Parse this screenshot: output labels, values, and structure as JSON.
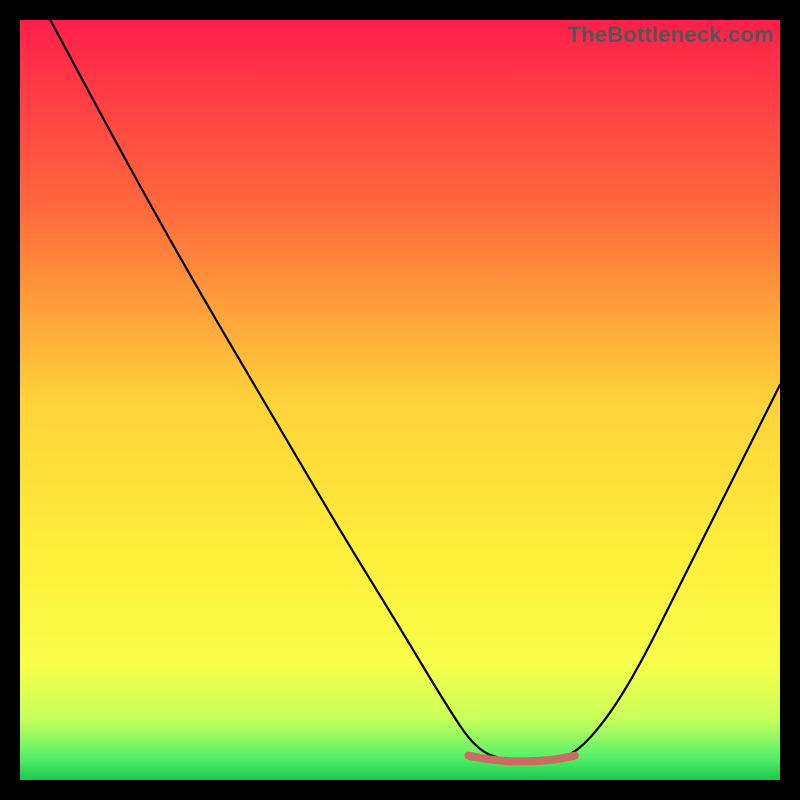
{
  "watermark": "TheBottleneck.com",
  "chart_data": {
    "type": "line",
    "title": "",
    "xlabel": "",
    "ylabel": "",
    "xlim": [
      0,
      100
    ],
    "ylim": [
      0,
      100
    ],
    "grid": false,
    "legend": false,
    "background_gradient": {
      "stops": [
        {
          "offset": 0.0,
          "color": "#ff1f4b"
        },
        {
          "offset": 0.25,
          "color": "#ff6a3c"
        },
        {
          "offset": 0.5,
          "color": "#ffd23a"
        },
        {
          "offset": 0.7,
          "color": "#ffee3a"
        },
        {
          "offset": 0.85,
          "color": "#f7ff4a"
        },
        {
          "offset": 0.92,
          "color": "#c8ff5a"
        },
        {
          "offset": 0.97,
          "color": "#57f06a"
        },
        {
          "offset": 1.0,
          "color": "#18c94a"
        }
      ]
    },
    "black_curve": {
      "description": "V-shaped line: steep descent from top-left, flat trough ~60-72, rise to right edge mid-height",
      "points": [
        {
          "x": 4,
          "y": 100
        },
        {
          "x": 12,
          "y": 85
        },
        {
          "x": 22,
          "y": 67
        },
        {
          "x": 32,
          "y": 50
        },
        {
          "x": 42,
          "y": 33
        },
        {
          "x": 50,
          "y": 20
        },
        {
          "x": 56,
          "y": 10
        },
        {
          "x": 60,
          "y": 4
        },
        {
          "x": 64,
          "y": 2.5
        },
        {
          "x": 70,
          "y": 2.5
        },
        {
          "x": 74,
          "y": 4
        },
        {
          "x": 80,
          "y": 12
        },
        {
          "x": 88,
          "y": 28
        },
        {
          "x": 96,
          "y": 44
        },
        {
          "x": 100,
          "y": 52
        }
      ]
    },
    "marker_trough": {
      "color": "#cc6b63",
      "thickness": 8,
      "points": [
        {
          "x": 59,
          "y": 3.2
        },
        {
          "x": 62,
          "y": 2.6
        },
        {
          "x": 66,
          "y": 2.4
        },
        {
          "x": 70,
          "y": 2.6
        },
        {
          "x": 73,
          "y": 3.2
        }
      ]
    }
  }
}
